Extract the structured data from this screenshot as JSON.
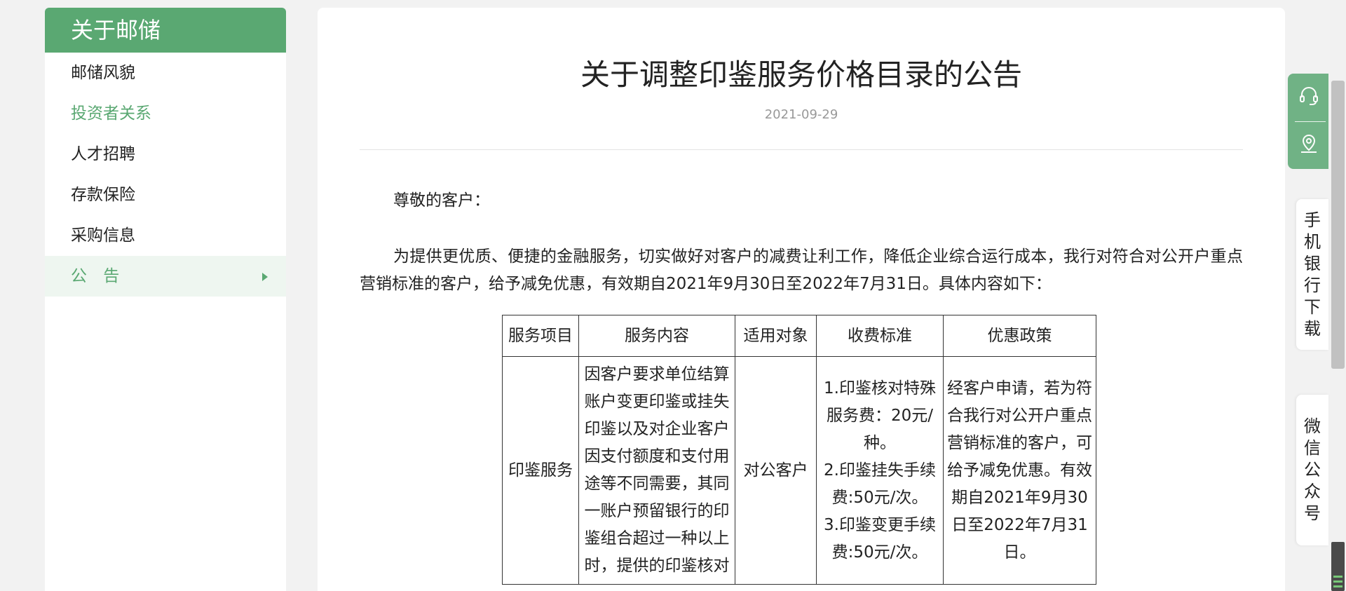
{
  "sidebar": {
    "title": "关于邮储",
    "items": [
      {
        "label": "邮储风貌"
      },
      {
        "label": "投资者关系"
      },
      {
        "label": "人才招聘"
      },
      {
        "label": "存款保险"
      },
      {
        "label": "采购信息"
      },
      {
        "label": "公告",
        "display": "公 告",
        "active": true
      }
    ]
  },
  "article": {
    "title": "关于调整印鉴服务价格目录的公告",
    "date": "2021-09-29",
    "greeting": "尊敬的客户：",
    "intro": "为提供更优质、便捷的金融服务，切实做好对客户的减费让利工作，降低企业综合运行成本，我行对符合对公开户重点营销标准的客户，给予减免优惠，有效期自2021年9月30日至2022年7月31日。具体内容如下：",
    "table": {
      "headers": [
        "服务项目",
        "服务内容",
        "适用对象",
        "收费标准",
        "优惠政策"
      ],
      "row": {
        "item": "印鉴服务",
        "content": "因客户要求单位结算账户变更印鉴或挂失印鉴以及对企业客户因支付额度和支付用途等不同需要，其同一账户预留银行的印鉴组合超过一种以上时，提供的印鉴核对",
        "target": "对公客户",
        "fee_1": "1.印鉴核对特殊服务费：20元/种。",
        "fee_2": "2.印鉴挂失手续费:50元/次。",
        "fee_3": "3.印鉴变更手续费:50元/次。",
        "policy": "经客户申请，若为符合我行对公开户重点营销标准的客户，可给予减免优惠。有效期自2021年9月30日至2022年7月31日。"
      }
    }
  },
  "float_widgets": {
    "service_icon": "headset-icon",
    "location_icon": "map-pin-icon",
    "app_download": [
      "手",
      "机",
      "银",
      "行",
      "下",
      "载"
    ],
    "wechat": [
      "微",
      "信",
      "公",
      "众",
      "号"
    ]
  },
  "colors": {
    "brand_green": "#5aa872",
    "active_bg": "#eef6f0",
    "date_gray": "#999999"
  }
}
